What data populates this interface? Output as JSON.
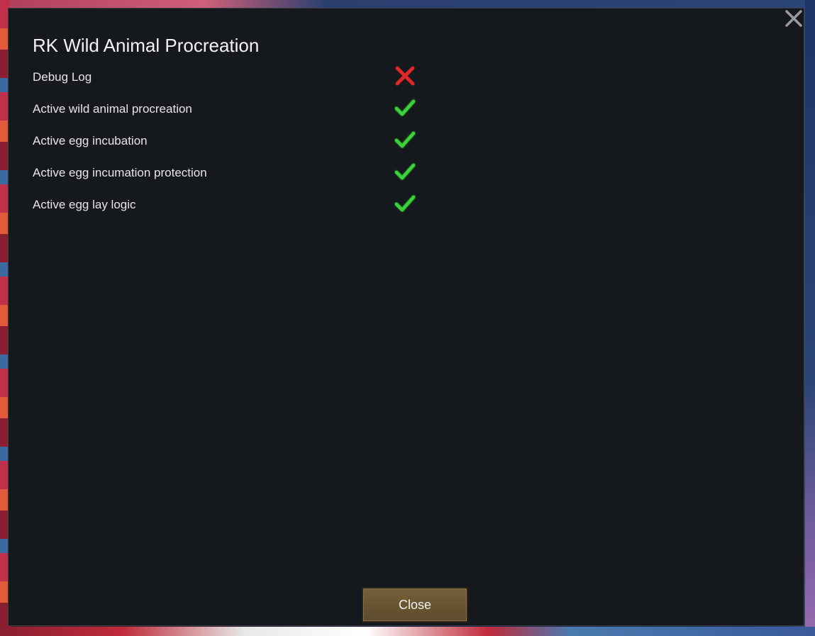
{
  "dialog": {
    "title": "RK Wild Animal Procreation",
    "settings": [
      {
        "label": "Debug Log",
        "enabled": false
      },
      {
        "label": "Active wild animal procreation",
        "enabled": true
      },
      {
        "label": "Active egg incubation",
        "enabled": true
      },
      {
        "label": "Active egg incumation protection",
        "enabled": true
      },
      {
        "label": "Active egg lay logic",
        "enabled": true
      }
    ],
    "close_button_label": "Close"
  },
  "icons": {
    "window_close": "close-x-icon",
    "checked": "checkmark-icon",
    "unchecked": "cross-icon"
  },
  "colors": {
    "dialog_bg": "#15191e",
    "check_green": "#3dd23d",
    "cross_red": "#e02626",
    "button_bg": "#6a5532"
  }
}
